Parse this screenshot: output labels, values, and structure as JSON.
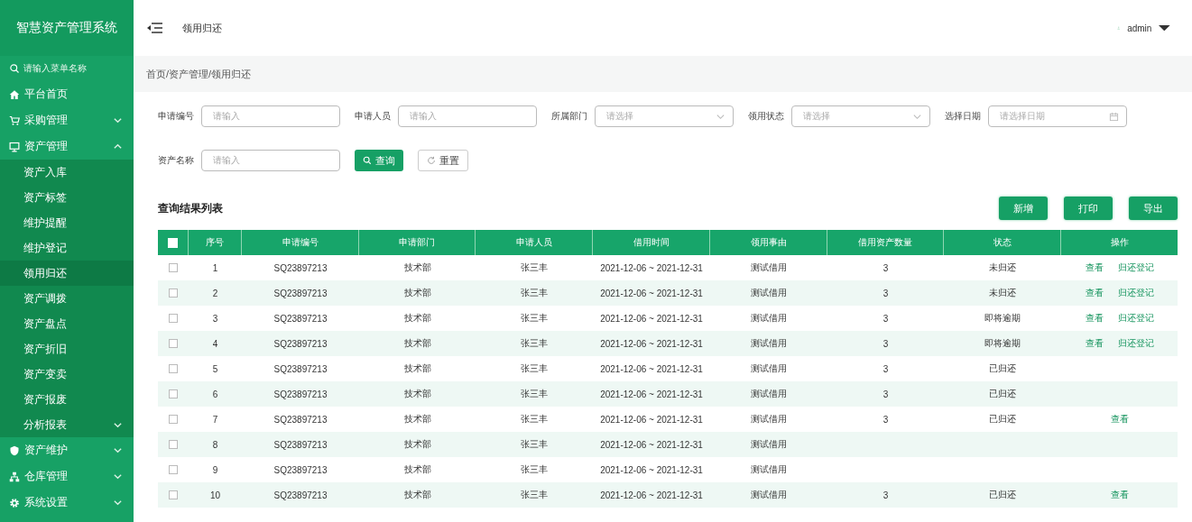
{
  "sidebar": {
    "title": "智慧资产管理系统",
    "search_placeholder": "请输入菜单名称",
    "items": [
      {
        "label": "平台首页",
        "selected": false
      },
      {
        "label": "采购管理",
        "selected": false,
        "expanded": false
      },
      {
        "label": "资产管理",
        "selected": false,
        "expanded": true,
        "children": [
          {
            "label": "资产入库",
            "selected": false
          },
          {
            "label": "资产标签",
            "selected": false
          },
          {
            "label": "维护提醒",
            "selected": false
          },
          {
            "label": "维护登记",
            "selected": false
          },
          {
            "label": "领用归还",
            "selected": true
          },
          {
            "label": "资产调拨",
            "selected": false
          },
          {
            "label": "资产盘点",
            "selected": false
          },
          {
            "label": "资产折旧",
            "selected": false
          },
          {
            "label": "资产变卖",
            "selected": false
          },
          {
            "label": "资产报废",
            "selected": false
          },
          {
            "label": "分析报表",
            "selected": false,
            "expanded": false
          }
        ]
      },
      {
        "label": "资产维护",
        "selected": false,
        "expanded": false
      },
      {
        "label": "仓库管理",
        "selected": false,
        "expanded": false
      },
      {
        "label": "系统设置",
        "selected": false,
        "expanded": false
      }
    ]
  },
  "header": {
    "title": "领用归还",
    "user": "admin"
  },
  "breadcrumb": "首页/资产管理/领用归还",
  "filter_rows": [
    {
      "fields": [
        {
          "kind": "input",
          "label": "申请编号",
          "placeholder": "请输入"
        },
        {
          "kind": "input",
          "label": "申请人员",
          "placeholder": "请输入"
        },
        {
          "kind": "select",
          "label": "所属部门",
          "placeholder": "请选择"
        },
        {
          "kind": "select",
          "label": "领用状态",
          "placeholder": "请选择"
        },
        {
          "kind": "date",
          "label": "选择日期",
          "placeholder": "请选择日期"
        }
      ]
    },
    {
      "fields": [
        {
          "kind": "input",
          "label": "资产名称",
          "placeholder": "请输入"
        }
      ],
      "buttons": [
        {
          "kind": "primary",
          "label": "查询"
        },
        {
          "kind": "default",
          "label": "重置"
        }
      ]
    }
  ],
  "table": {
    "title": "查询结果列表",
    "toolbar_buttons": [
      "新增",
      "打印",
      "导出"
    ],
    "header_checked": false,
    "columns": [
      "序号",
      "申请编号",
      "申请部门",
      "申请人员",
      "借用时间",
      "领用事由",
      "借用资产数量",
      "状态",
      "操作"
    ],
    "rows": [
      {
        "checked": false,
        "no": "1",
        "code": "SQ23897213",
        "dept": "技术部",
        "person": "张三丰",
        "period": "2021-12-06 ~ 2021-12-31",
        "reason": "测试借用",
        "qty": "3",
        "status": "未归还",
        "actions": [
          "查看",
          "归还登记"
        ]
      },
      {
        "checked": false,
        "no": "2",
        "code": "SQ23897213",
        "dept": "技术部",
        "person": "张三丰",
        "period": "2021-12-06 ~ 2021-12-31",
        "reason": "测试借用",
        "qty": "3",
        "status": "未归还",
        "actions": [
          "查看",
          "归还登记"
        ]
      },
      {
        "checked": false,
        "no": "3",
        "code": "SQ23897213",
        "dept": "技术部",
        "person": "张三丰",
        "period": "2021-12-06 ~ 2021-12-31",
        "reason": "测试借用",
        "qty": "3",
        "status": "即将逾期",
        "actions": [
          "查看",
          "归还登记"
        ]
      },
      {
        "checked": false,
        "no": "4",
        "code": "SQ23897213",
        "dept": "技术部",
        "person": "张三丰",
        "period": "2021-12-06 ~ 2021-12-31",
        "reason": "测试借用",
        "qty": "3",
        "status": "即将逾期",
        "actions": [
          "查看",
          "归还登记"
        ]
      },
      {
        "checked": false,
        "no": "5",
        "code": "SQ23897213",
        "dept": "技术部",
        "person": "张三丰",
        "period": "2021-12-06 ~ 2021-12-31",
        "reason": "测试借用",
        "qty": "3",
        "status": "已归还"
      },
      {
        "checked": false,
        "no": "6",
        "code": "SQ23897213",
        "dept": "技术部",
        "person": "张三丰",
        "period": "2021-12-06 ~ 2021-12-31",
        "reason": "测试借用",
        "qty": "3",
        "status": "已归还"
      },
      {
        "checked": false,
        "no": "7",
        "code": "SQ23897213",
        "dept": "技术部",
        "person": "张三丰",
        "period": "2021-12-06 ~ 2021-12-31",
        "reason": "测试借用",
        "qty": "3",
        "status": "已归还",
        "actions": [
          "查看"
        ]
      },
      {
        "checked": false,
        "no": "8",
        "code": "SQ23897213",
        "dept": "技术部",
        "person": "张三丰",
        "period": "2021-12-06 ~ 2021-12-31",
        "reason": "测试借用"
      },
      {
        "checked": false,
        "no": "9",
        "code": "SQ23897213",
        "dept": "技术部",
        "person": "张三丰",
        "period": "2021-12-06 ~ 2021-12-31",
        "reason": "测试借用"
      },
      {
        "checked": false,
        "no": "10",
        "code": "SQ23897213",
        "dept": "技术部",
        "person": "张三丰",
        "period": "2021-12-06 ~ 2021-12-31",
        "reason": "测试借用",
        "qty": "3",
        "status": "已归还",
        "actions": [
          "查看"
        ]
      }
    ]
  }
}
